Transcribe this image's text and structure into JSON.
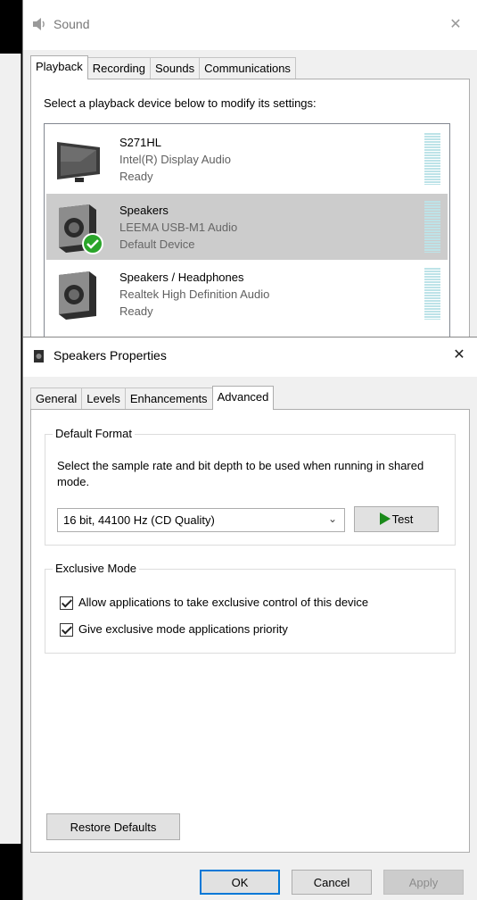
{
  "sound_window": {
    "title": "Sound",
    "close_glyph": "✕",
    "tabs": [
      {
        "label": "Playback",
        "active": true
      },
      {
        "label": "Recording",
        "active": false
      },
      {
        "label": "Sounds",
        "active": false
      },
      {
        "label": "Communications",
        "active": false
      }
    ],
    "instruction": "Select a playback device below to modify its settings:",
    "devices": [
      {
        "name": "S271HL",
        "driver": "Intel(R) Display Audio",
        "status": "Ready",
        "icon": "monitor-icon",
        "selected": false
      },
      {
        "name": "Speakers",
        "driver": "LEEMA USB-M1 Audio",
        "status": "Default Device",
        "icon": "speaker-icon",
        "selected": true
      },
      {
        "name": "Speakers / Headphones",
        "driver": "Realtek High Definition Audio",
        "status": "Ready",
        "icon": "speaker-icon",
        "selected": false
      }
    ]
  },
  "props_window": {
    "title": "Speakers Properties",
    "close_glyph": "✕",
    "tabs": [
      {
        "label": "General",
        "active": false
      },
      {
        "label": "Levels",
        "active": false
      },
      {
        "label": "Enhancements",
        "active": false
      },
      {
        "label": "Advanced",
        "active": true
      }
    ],
    "default_format": {
      "legend": "Default Format",
      "description": "Select the sample rate and bit depth to be used when running in shared mode.",
      "selected_format": "16 bit, 44100 Hz (CD Quality)",
      "test_label": "Test"
    },
    "exclusive_mode": {
      "legend": "Exclusive Mode",
      "options": [
        {
          "label": "Allow applications to take exclusive control of this device",
          "checked": true
        },
        {
          "label": "Give exclusive mode applications priority",
          "checked": true
        }
      ]
    },
    "restore_label": "Restore Defaults",
    "buttons": {
      "ok": "OK",
      "cancel": "Cancel",
      "apply": "Apply"
    }
  },
  "colors": {
    "selection": "#cccccc",
    "check_green": "#2aa52a",
    "focus_blue": "#0078d7",
    "meter": "#bde3e8"
  }
}
